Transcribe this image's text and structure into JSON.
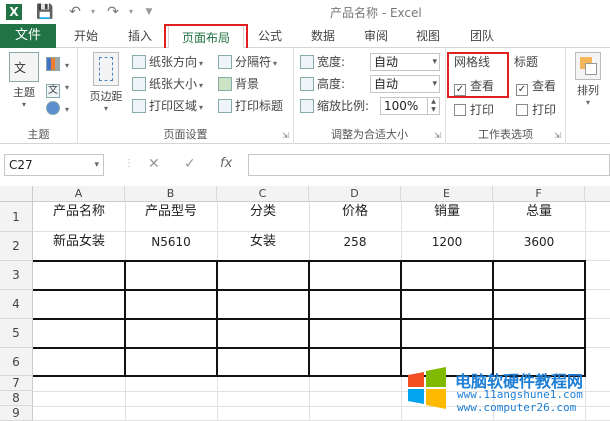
{
  "app": {
    "title": "产品名称 - Excel"
  },
  "qat": {
    "save_icon": "save-icon",
    "undo_icon": "undo-icon",
    "redo_icon": "redo-icon",
    "customize_icon": "customize-icon"
  },
  "tabs": [
    {
      "label": "文件"
    },
    {
      "label": "开始"
    },
    {
      "label": "插入"
    },
    {
      "label": "页面布局"
    },
    {
      "label": "公式"
    },
    {
      "label": "数据"
    },
    {
      "label": "审阅"
    },
    {
      "label": "视图"
    },
    {
      "label": "团队"
    }
  ],
  "ribbon": {
    "themes": {
      "label": "主题",
      "group": "主题"
    },
    "page_setup": {
      "group": "页面设置",
      "margins": "页边距",
      "orientation": "纸张方向",
      "size": "纸张大小",
      "print_area": "打印区域",
      "breaks": "分隔符",
      "background": "背景",
      "print_titles": "打印标题"
    },
    "scale": {
      "group": "调整为合适大小",
      "width_label": "宽度:",
      "width_value": "自动",
      "height_label": "高度:",
      "height_value": "自动",
      "zoom_label": "缩放比例:",
      "zoom_value": "100%"
    },
    "sheet_options": {
      "group": "工作表选项",
      "gridlines": "网格线",
      "gridlines_view": "查看",
      "gridlines_print": "打印",
      "headings": "标题",
      "headings_view": "查看",
      "headings_print": "打印"
    },
    "arrange": {
      "label": "排列"
    }
  },
  "formula_bar": {
    "name_box": "C27",
    "cancel": "✕",
    "enter": "✓",
    "fx": "fx",
    "value": ""
  },
  "sheet": {
    "columns": [
      "A",
      "B",
      "C",
      "D",
      "E",
      "F"
    ],
    "rows": [
      "1",
      "2",
      "3",
      "4",
      "5",
      "6",
      "7",
      "8",
      "9"
    ],
    "header_row": [
      "产品名称",
      "产品型号",
      "分类",
      "价格",
      "销量",
      "总量"
    ],
    "data_row": [
      "新品女装",
      "N5610",
      "女装",
      "258",
      "1200",
      "3600"
    ]
  },
  "watermark": {
    "title": "电脑软硬件教程网",
    "url1": "www.11angshune1.com",
    "url2": "www.computer26.com"
  },
  "colors": {
    "accent": "#217346",
    "highlight": "#e02020",
    "watermark": "#1e7fd6"
  }
}
